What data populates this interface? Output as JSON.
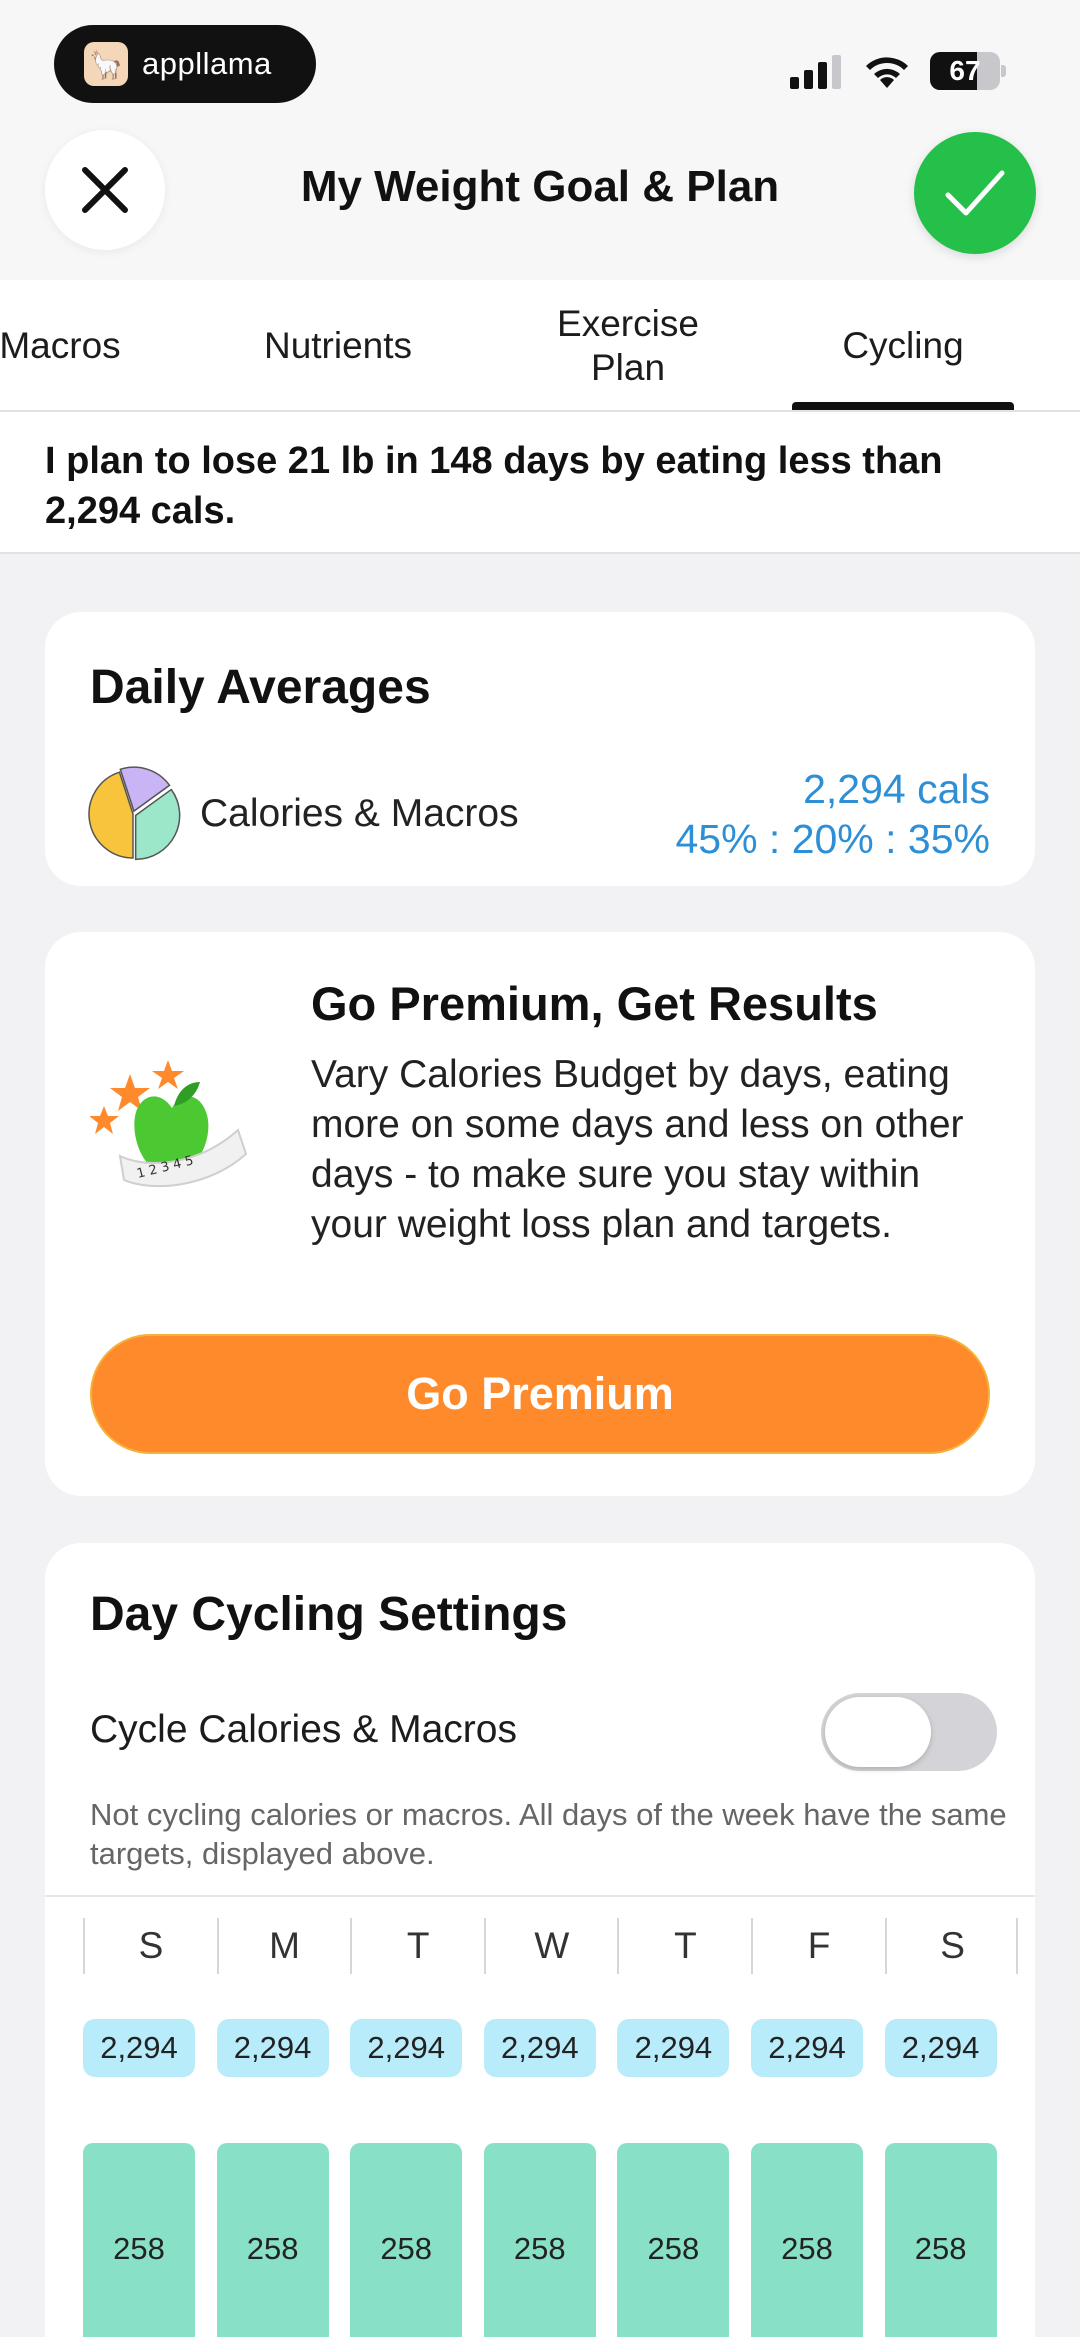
{
  "status_bar": {
    "app_name": "appllama",
    "battery": "67",
    "battery_level": 0.67
  },
  "header": {
    "title": "My Weight Goal & Plan"
  },
  "tabs": [
    {
      "label": "Macros"
    },
    {
      "label": "Nutrients"
    },
    {
      "label": "Exercise Plan"
    },
    {
      "label": "Cycling",
      "active": true
    }
  ],
  "plan_summary": "I plan to lose 21 lb in 148 days by eating less than 2,294 cals.",
  "daily_averages": {
    "title": "Daily Averages",
    "label": "Calories & Macros",
    "calories": "2,294 cals",
    "macros_ratio": "45% : 20% : 35%",
    "pie_slices": [
      45,
      20,
      35
    ]
  },
  "premium": {
    "title": "Go Premium, Get Results",
    "description": "Vary Calories Budget by days, eating more on some days and less on other days - to make sure you stay within your weight loss plan and targets.",
    "button": "Go Premium",
    "tape_numbers": "1 2 3 4 5"
  },
  "cycling": {
    "title": "Day Cycling Settings",
    "toggle_label": "Cycle Calories & Macros",
    "toggle_on": false,
    "note": "Not cycling calories or macros. All days of the week have the same targets, displayed above.",
    "days": [
      "S",
      "M",
      "T",
      "W",
      "T",
      "F",
      "S"
    ],
    "calories": [
      "2,294",
      "2,294",
      "2,294",
      "2,294",
      "2,294",
      "2,294",
      "2,294"
    ],
    "bars": [
      "258",
      "258",
      "258",
      "258",
      "258",
      "258",
      "258"
    ]
  },
  "colors": {
    "accent_blue": "#2d8fd5",
    "premium_orange": "#ff8a2b",
    "confirm_green": "#25c04a",
    "bar_green": "#88e0c6",
    "chip_blue": "#b8ecfb"
  }
}
